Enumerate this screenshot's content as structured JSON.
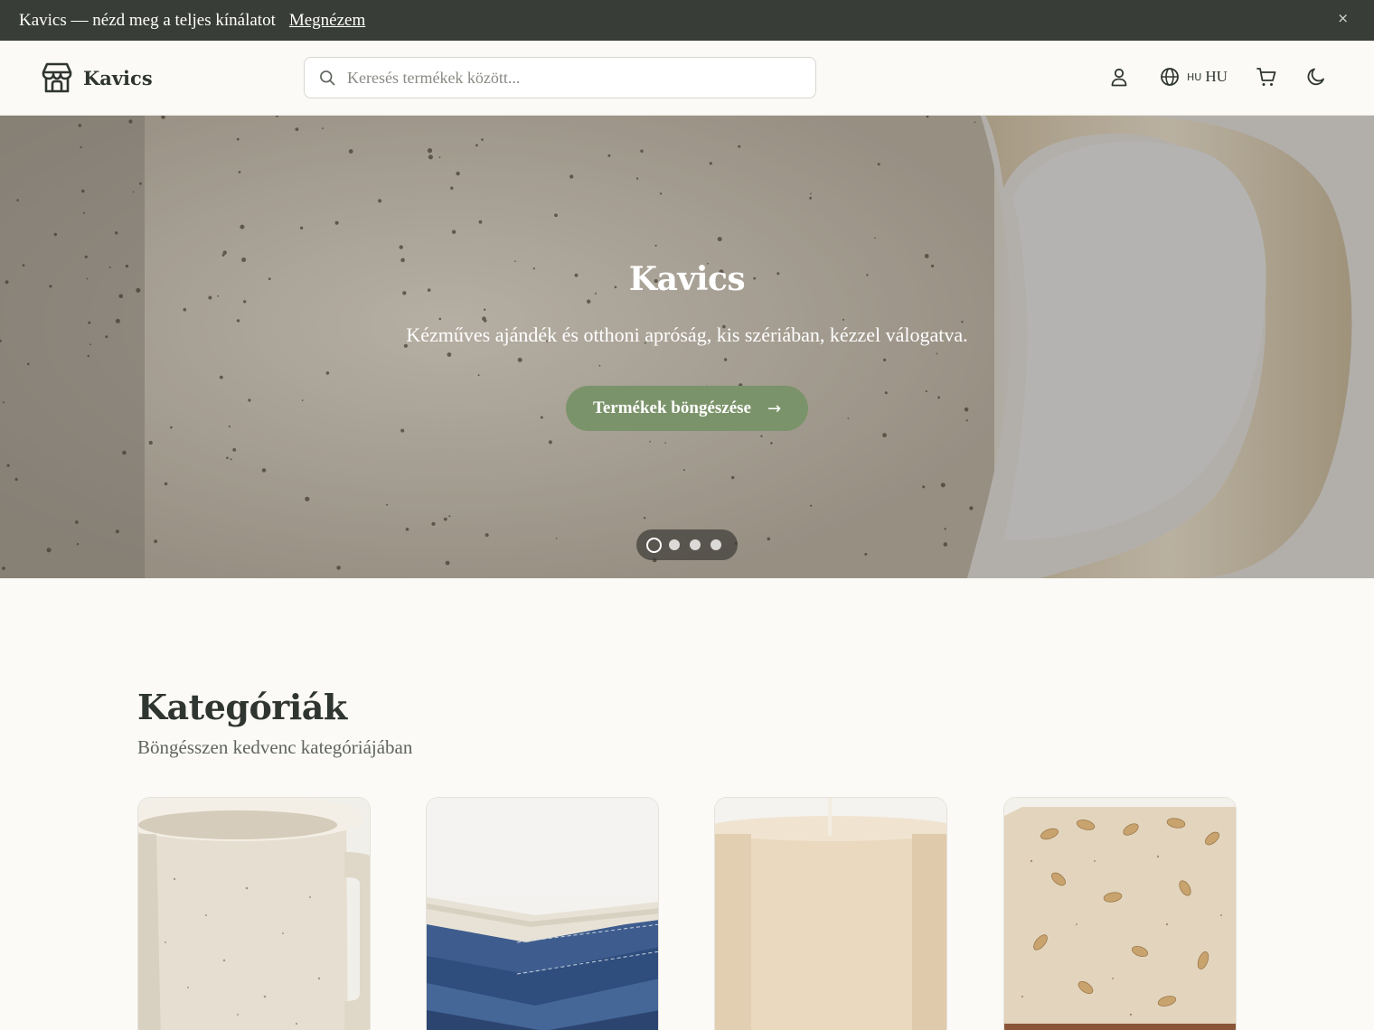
{
  "announcement": {
    "text": "Kavics — nézd meg a teljes kínálatot",
    "link": "Megnézem",
    "close": "×"
  },
  "header": {
    "brand": "Kavics",
    "search_placeholder": "Keresés termékek között...",
    "lang_code_small": "HU",
    "lang_code": "HU"
  },
  "hero": {
    "title": "Kavics",
    "subtitle": "Kézműves ajándék és otthoni apróság, kis szériában, kézzel válogatva.",
    "cta": "Termékek böngészése",
    "cta_arrow": "→",
    "slides_count": 4,
    "active_slide": 1
  },
  "categories": {
    "title": "Kategóriák",
    "subtitle": "Böngésszen kedvenc kategóriájában",
    "cards": [
      {
        "icon": "mug-image"
      },
      {
        "icon": "textile-image"
      },
      {
        "icon": "candle-image"
      },
      {
        "icon": "soap-image"
      }
    ]
  },
  "colors": {
    "announcement_bg": "#393d37",
    "accent_green": "#7b936a",
    "page_bg": "#fbfaf7",
    "text": "#2f3530"
  }
}
